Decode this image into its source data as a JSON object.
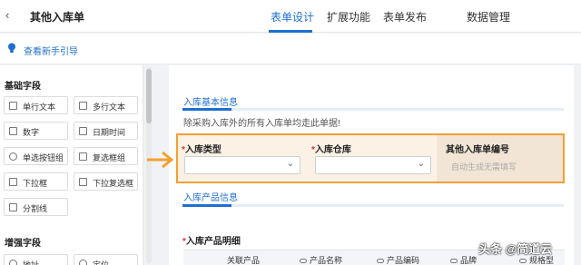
{
  "header": {
    "back_icon": "chevron-left-icon",
    "app_title": "其他入库单",
    "tabs": [
      {
        "label": "表单设计",
        "active": true
      },
      {
        "label": "扩展功能",
        "active": false
      },
      {
        "label": "表单发布",
        "active": false
      },
      {
        "label": "数据管理",
        "active": false
      }
    ]
  },
  "guide": {
    "icon": "lightbulb-icon",
    "label": "查看新手引导"
  },
  "sidebar": {
    "basic_title": "基础字段",
    "basic_fields": [
      {
        "label": "单行文本",
        "icon": "single-line-text-icon"
      },
      {
        "label": "多行文本",
        "icon": "multi-line-text-icon"
      },
      {
        "label": "数字",
        "icon": "number-icon"
      },
      {
        "label": "日期时间",
        "icon": "date-time-icon"
      },
      {
        "label": "单选按钮组",
        "icon": "radio-group-icon"
      },
      {
        "label": "复选框组",
        "icon": "checkbox-group-icon"
      },
      {
        "label": "下拉框",
        "icon": "dropdown-icon"
      },
      {
        "label": "下拉复选框",
        "icon": "dropdown-checkbox-icon"
      },
      {
        "label": "分割线",
        "icon": "divider-icon"
      }
    ],
    "advanced_title": "增强字段",
    "advanced_fields": [
      {
        "label": "地址",
        "icon": "address-icon"
      },
      {
        "label": "定位",
        "icon": "location-icon"
      }
    ]
  },
  "form": {
    "section1_title": "入库基本信息",
    "section1_desc": "除采购入库外的所有入库单均走此单据!",
    "fields": [
      {
        "required": "*",
        "label": "入库类型"
      },
      {
        "required": "*",
        "label": "入库仓库"
      }
    ],
    "auto_field": {
      "label": "其他入库单编号",
      "placeholder": "自动生成无需填写"
    },
    "section2_title": "入库产品信息",
    "table_title_required": "*",
    "table_title": "入库产品明细",
    "table_columns": [
      "关联产品",
      "产品名称",
      "产品编码",
      "品牌",
      "规格型"
    ]
  },
  "colors": {
    "accent": "#1f6fd0",
    "highlight_border": "#f2a033",
    "highlight_fill": "#fbf1e4",
    "required": "#e03030"
  },
  "watermark": "头条 @简道云"
}
